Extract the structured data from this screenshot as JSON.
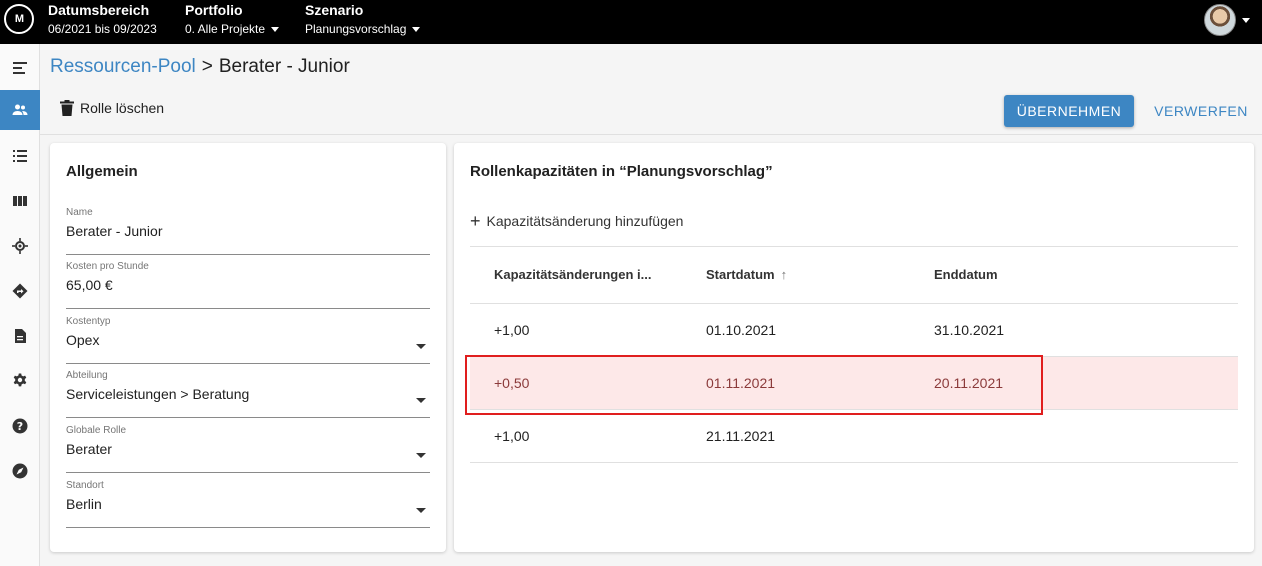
{
  "topbar": {
    "logo_text": "M",
    "date_range": {
      "title": "Datumsbereich",
      "value": "06/2021 bis 09/2023"
    },
    "portfolio": {
      "title": "Portfolio",
      "value": "0. Alle Projekte"
    },
    "scenario": {
      "title": "Szenario",
      "value": "Planungsvorschlag"
    }
  },
  "sidenav": [
    {
      "icon": "menu-collapse-icon",
      "active": false
    },
    {
      "icon": "people-icon",
      "active": true
    },
    {
      "icon": "list-icon",
      "active": false
    },
    {
      "icon": "columns-icon",
      "active": false
    },
    {
      "icon": "target-icon",
      "active": false
    },
    {
      "icon": "directions-icon",
      "active": false
    },
    {
      "icon": "document-icon",
      "active": false
    },
    {
      "icon": "gear-icon",
      "active": false
    },
    {
      "icon": "help-icon",
      "active": false
    },
    {
      "icon": "compass-icon",
      "active": false
    }
  ],
  "breadcrumb": {
    "parent": "Ressourcen-Pool",
    "separator": ">",
    "current": "Berater - Junior"
  },
  "toolbar": {
    "delete_label": "Rolle löschen",
    "apply_label": "ÜBERNEHMEN",
    "discard_label": "VERWERFEN"
  },
  "general": {
    "title": "Allgemein",
    "fields": [
      {
        "label": "Name",
        "value": "Berater - Junior",
        "dropdown": false
      },
      {
        "label": "Kosten pro Stunde",
        "value": "65,00 €",
        "dropdown": false
      },
      {
        "label": "Kostentyp",
        "value": "Opex",
        "dropdown": true
      },
      {
        "label": "Abteilung",
        "value": "Serviceleistungen > Beratung",
        "dropdown": true
      },
      {
        "label": "Globale Rolle",
        "value": "Berater",
        "dropdown": true
      },
      {
        "label": "Standort",
        "value": "Berlin",
        "dropdown": true
      }
    ]
  },
  "capacities": {
    "title": "Rollenkapazitäten in “Planungsvorschlag”",
    "add_label": "Kapazitätsänderung hinzufügen",
    "columns": [
      "Kapazitätsänderungen i...",
      "Startdatum",
      "Enddatum"
    ],
    "sort_indicator": "↑",
    "rows": [
      {
        "change": "+1,00",
        "start": "01.10.2021",
        "end": "31.10.2021",
        "highlighted": false
      },
      {
        "change": "+0,50",
        "start": "01.11.2021",
        "end": "20.11.2021",
        "highlighted": true
      },
      {
        "change": "+1,00",
        "start": "21.11.2021",
        "end": "",
        "highlighted": false
      }
    ]
  },
  "colors": {
    "accent": "#3d86c3",
    "highlight_fill": "#fde8e8",
    "highlight_border": "#e01e1e"
  }
}
